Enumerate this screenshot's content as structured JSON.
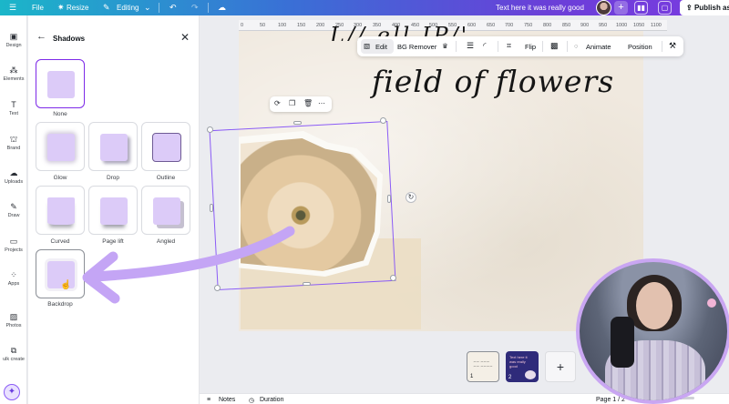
{
  "topbar": {
    "file": "File",
    "resize": "Resize",
    "editing": "Editing",
    "doc_title": "Text here it was really good",
    "publish": "Publish as"
  },
  "rail": {
    "items": [
      {
        "label": "Design",
        "icon": "design-icon"
      },
      {
        "label": "Elements",
        "icon": "elements-icon"
      },
      {
        "label": "Text",
        "icon": "text-icon"
      },
      {
        "label": "Brand",
        "icon": "brand-icon"
      },
      {
        "label": "Uploads",
        "icon": "uploads-icon"
      },
      {
        "label": "Draw",
        "icon": "draw-icon"
      },
      {
        "label": "Projects",
        "icon": "projects-icon"
      },
      {
        "label": "Apps",
        "icon": "apps-icon"
      },
      {
        "label": "Photos",
        "icon": "photos-icon"
      },
      {
        "label": "ulk create",
        "icon": "bulk-create-icon"
      }
    ]
  },
  "panel": {
    "title": "Shadows",
    "options": [
      {
        "label": "None",
        "style": "none",
        "selected": true
      },
      {
        "label": "Glow",
        "style": "glow"
      },
      {
        "label": "Drop",
        "style": "drop"
      },
      {
        "label": "Outline",
        "style": "outline"
      },
      {
        "label": "Curved",
        "style": "curved"
      },
      {
        "label": "Page lift",
        "style": "pagelift"
      },
      {
        "label": "Angled",
        "style": "angled"
      },
      {
        "label": "Backdrop",
        "style": "backdrop",
        "hovered": true
      }
    ]
  },
  "ruler": {
    "ticks": [
      "0",
      "50",
      "100",
      "150",
      "200",
      "250",
      "300",
      "350",
      "400",
      "450",
      "500",
      "550",
      "600",
      "650",
      "700",
      "750",
      "800",
      "850",
      "900",
      "950",
      "1000",
      "1050",
      "1100"
    ]
  },
  "context_toolbar": {
    "edit": "Edit",
    "bg_remover": "BG Remover",
    "flip": "Flip",
    "animate": "Animate",
    "position": "Position"
  },
  "canvas": {
    "script_line": "field of flowers",
    "script_top": "L//  ell  IP/'"
  },
  "pages": {
    "thumb1_num": "1",
    "thumb2_num": "2",
    "thumb2_text": "Text here it was really good",
    "add": "+"
  },
  "status": {
    "notes": "Notes",
    "duration": "Duration",
    "page": "Page 1 / 2",
    "zoom_fraction": 0.8
  },
  "colors": {
    "accent": "#7d2ae8",
    "selection": "#8b5cf6",
    "arrow": "#c4a5f5",
    "thumb_fill": "#dccbf8"
  }
}
